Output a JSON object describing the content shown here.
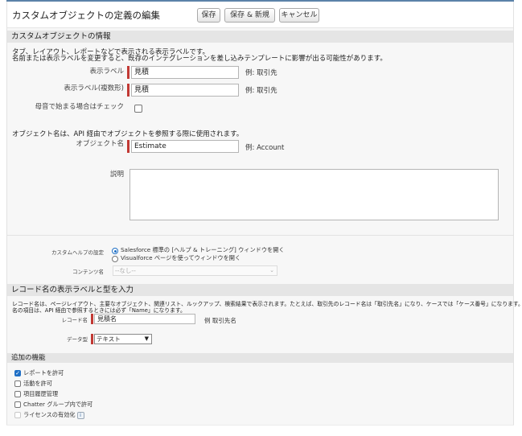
{
  "header": {
    "title": "カスタムオブジェクトの定義の編集",
    "buttons": {
      "save": "保存",
      "save_new": "保存 & 新規",
      "cancel": "キャンセル"
    }
  },
  "info_section": {
    "title": "カスタムオブジェクトの情報",
    "desc_line1": "タブ、レイアウト、レポートなどで表示される表示ラベルです。",
    "desc_line2": "名前または表示ラベルを変更すると、既存のインテグレーションを差し込みテンプレートに影響が出る可能性があります。",
    "label": {
      "label": "表示ラベル",
      "value": "見積",
      "example": "例: 取引先"
    },
    "plural_label": {
      "label": "表示ラベル(複数形)",
      "value": "見積",
      "example": "例: 取引先"
    },
    "vowel": {
      "label": "母音で始まる場合はチェック",
      "checked": false
    },
    "api_note": "オブジェクト名は、API 経由でオブジェクトを参照する際に使用されます。",
    "object_name": {
      "label": "オブジェクト名",
      "value": "Estimate",
      "example": "例: Account"
    },
    "description": {
      "label": "説明",
      "value": ""
    }
  },
  "help_section": {
    "label": "カスタムヘルプの設定",
    "option1": "Salesforce 標準の [ヘルプ & トレーニング] ウィンドウを開く",
    "option2": "Visualforce ページを使ってウィンドウを開く",
    "content_label": "コンテンツ名",
    "content_value": "--なし--"
  },
  "record_name_section": {
    "title": "レコード名の表示ラベルと型を入力",
    "desc_line1": "レコード名は、ページレイアウト、主要なオブジェクト、関連リスト、ルックアップ、検索結果で表示されます。たとえば、取引先のレコード名は「取引先名」になり、ケースでは「ケース番号」になります。レコード",
    "desc_line2": "名の項目は、API 経由で参照するときには必ず「Name」になります。",
    "record_name": {
      "label": "レコード名",
      "value": "見積名",
      "example": "例 取引先名"
    },
    "data_type": {
      "label": "データ型",
      "value": "テキスト"
    }
  },
  "features_section": {
    "title": "追加の機能",
    "items": [
      {
        "label": "レポートを許可",
        "checked": true
      },
      {
        "label": "活動を許可",
        "checked": false
      },
      {
        "label": "項目履歴管理",
        "checked": false
      },
      {
        "label": "Chatter グループ内で許可",
        "checked": false
      },
      {
        "label": "ライセンスの有効化",
        "checked": false,
        "disabled": true
      }
    ],
    "info_icon_text": "i"
  },
  "colors": {
    "required": "#c23934",
    "accent": "#1f6fc5",
    "section_bg": "#e5e5e5"
  }
}
